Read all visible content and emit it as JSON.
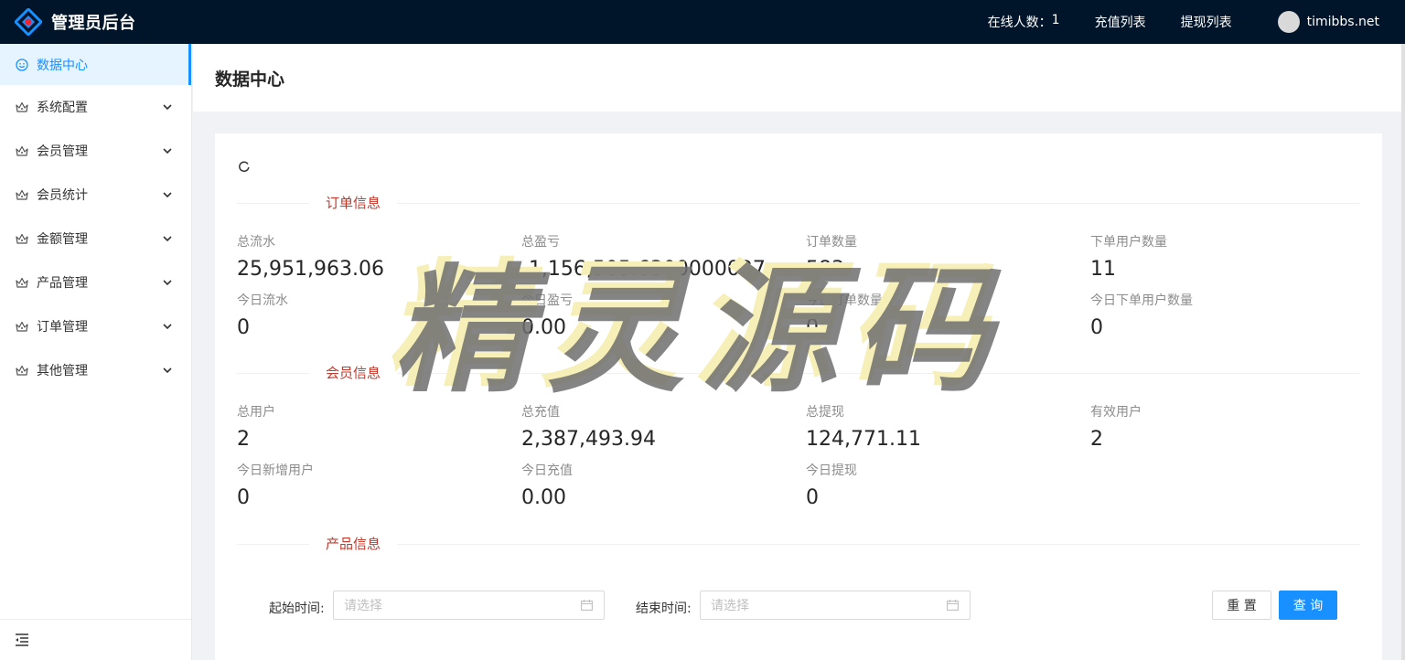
{
  "header": {
    "title": "管理员后台",
    "online_label": "在线人数：",
    "online_count": "1",
    "recharge_list": "充值列表",
    "withdraw_list": "提现列表",
    "username": "timibbs.net"
  },
  "sidebar": {
    "items": [
      {
        "label": "数据中心",
        "icon": "smile-icon"
      },
      {
        "label": "系统配置",
        "icon": "crown-icon"
      },
      {
        "label": "会员管理",
        "icon": "crown-icon"
      },
      {
        "label": "会员统计",
        "icon": "crown-icon"
      },
      {
        "label": "金额管理",
        "icon": "crown-icon"
      },
      {
        "label": "产品管理",
        "icon": "crown-icon"
      },
      {
        "label": "订单管理",
        "icon": "crown-icon"
      },
      {
        "label": "其他管理",
        "icon": "crown-icon"
      }
    ]
  },
  "page": {
    "title": "数据中心"
  },
  "sections": {
    "orders": {
      "title": "订单信息",
      "stats": [
        {
          "label": "总流水",
          "value": "25,951,963.06"
        },
        {
          "label": "总盈亏",
          "value": "-1,156,505.6300000027"
        },
        {
          "label": "订单数量",
          "value": "583"
        },
        {
          "label": "下单用户数量",
          "value": "11"
        },
        {
          "label": "今日流水",
          "value": "0"
        },
        {
          "label": "今日盈亏",
          "value": "0.00"
        },
        {
          "label": "今日订单数量",
          "value": "0"
        },
        {
          "label": "今日下单用户数量",
          "value": "0"
        }
      ]
    },
    "members": {
      "title": "会员信息",
      "stats": [
        {
          "label": "总用户",
          "value": "2"
        },
        {
          "label": "总充值",
          "value": "2,387,493.94"
        },
        {
          "label": "总提现",
          "value": "124,771.11"
        },
        {
          "label": "有效用户",
          "value": "2"
        },
        {
          "label": "今日新增用户",
          "value": "0"
        },
        {
          "label": "今日充值",
          "value": "0.00"
        },
        {
          "label": "今日提现",
          "value": "0"
        }
      ]
    },
    "products": {
      "title": "产品信息"
    }
  },
  "filter": {
    "start_label": "起始时间:",
    "start_placeholder": "请选择",
    "end_label": "结束时间:",
    "end_placeholder": "请选择",
    "reset": "重 置",
    "query": "查 询"
  },
  "watermark": "精灵源码",
  "colors": {
    "header_bg": "#001529",
    "primary": "#1890ff",
    "section_title": "#c0392b"
  }
}
